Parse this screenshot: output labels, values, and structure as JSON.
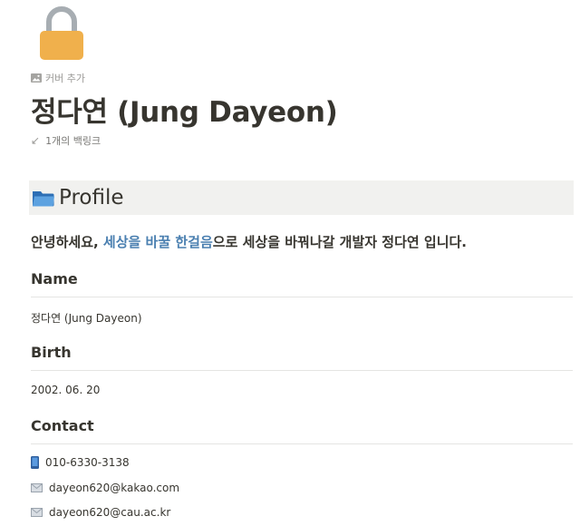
{
  "page": {
    "icon": "lock-icon",
    "add_cover_label": "커버 추가",
    "title": "정다연 (Jung Dayeon)",
    "backlinks_label": "1개의 백링크"
  },
  "callout": {
    "icon": "folder-icon",
    "heading": "Profile",
    "background_color": "#f1f1ef"
  },
  "intro": {
    "before": "안녕하세요, ",
    "highlight": "세상을 바꿀 한걸음",
    "after": "으로 세상을 바꿔나갈 개발자 정다연 입니다.",
    "highlight_color": "#4a7fb0"
  },
  "sections": {
    "name": {
      "heading": "Name",
      "value": "정다연 (Jung Dayeon)"
    },
    "birth": {
      "heading": "Birth",
      "value": "2002. 06. 20"
    },
    "contact": {
      "heading": "Contact",
      "items": [
        {
          "icon": "mobile-phone-icon",
          "text": "010-6330-3138"
        },
        {
          "icon": "envelope-icon",
          "text": "dayeon620@kakao.com"
        },
        {
          "icon": "envelope-icon",
          "text": "dayeon620@cau.ac.kr"
        }
      ]
    }
  }
}
